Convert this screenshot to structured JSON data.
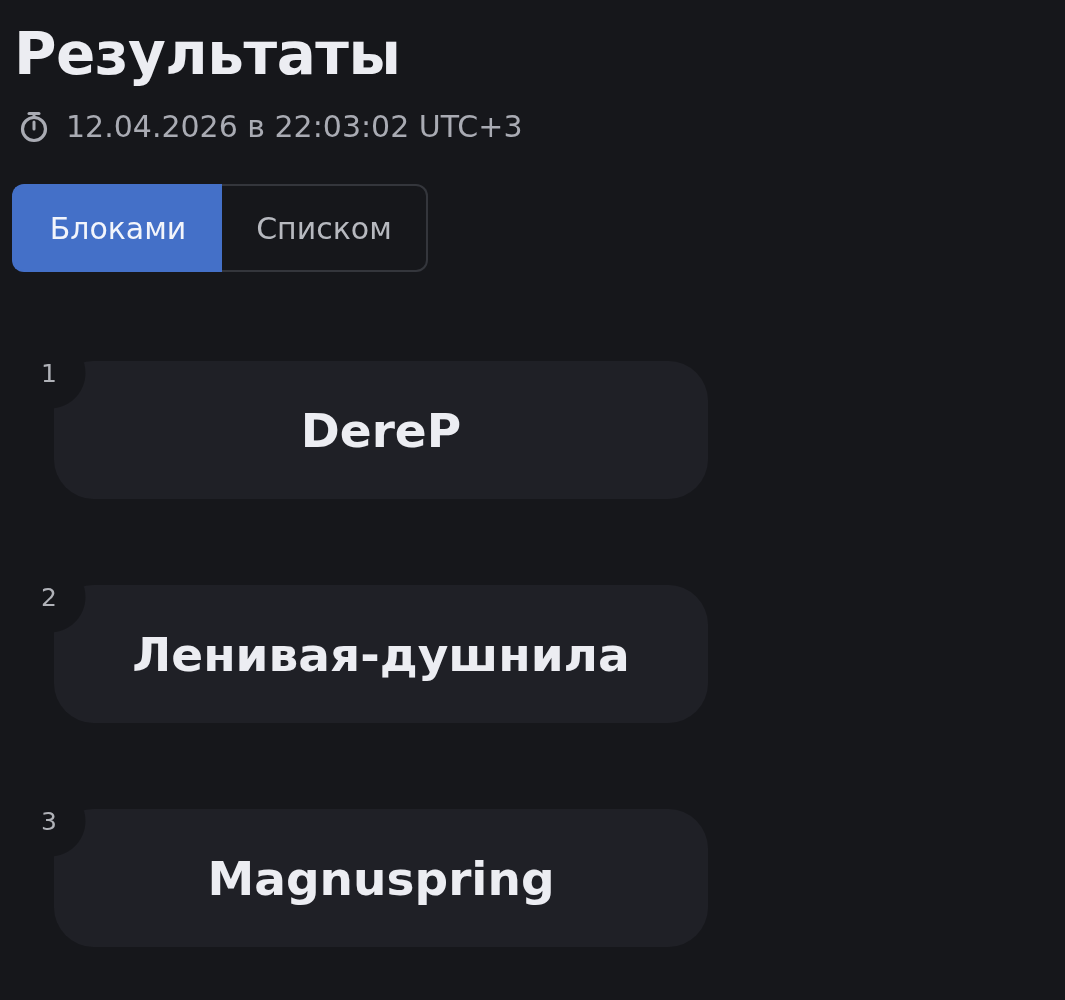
{
  "header": {
    "title": "Результаты",
    "timestamp": "12.04.2026 в 22:03:02 UTC+3"
  },
  "view_toggle": [
    {
      "label": "Блоками",
      "selected": true
    },
    {
      "label": "Списком",
      "selected": false
    }
  ],
  "results": [
    {
      "rank": "1",
      "name": "DereP"
    },
    {
      "rank": "2",
      "name": "Ленивая-душнила"
    },
    {
      "rank": "3",
      "name": "Magnuspring"
    }
  ]
}
